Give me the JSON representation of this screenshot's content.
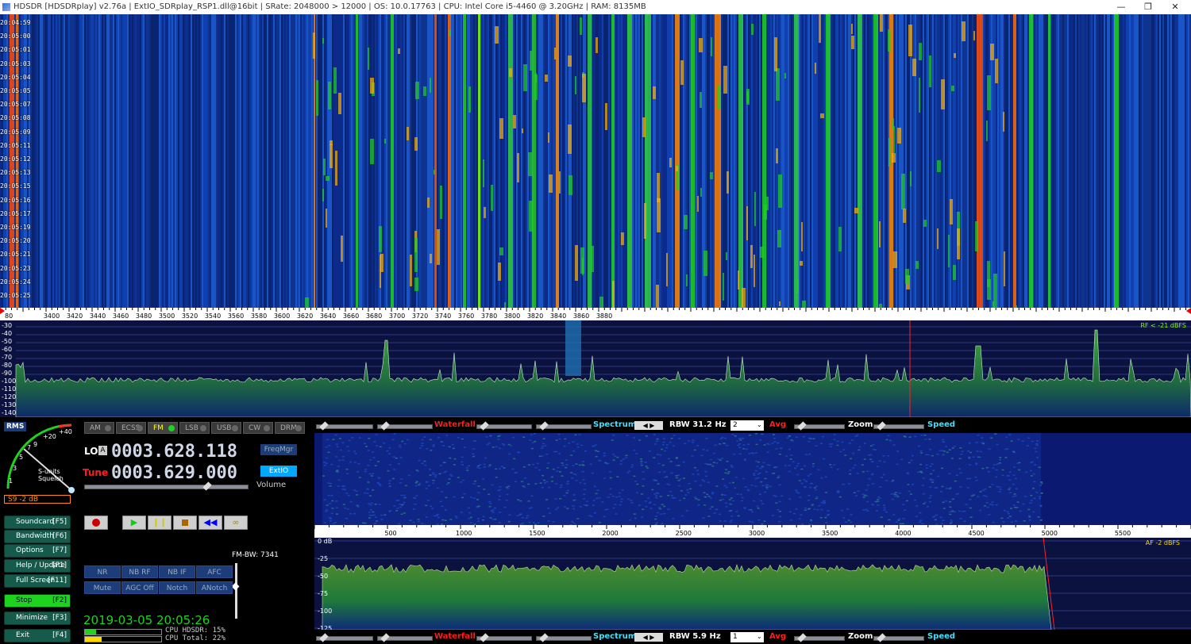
{
  "titlebar": {
    "title": "HDSDR  [HDSDRplay]  v2.76a  |  ExtIO_SDRplay_RSP1.dll@16bit  |  SRate: 2048000 > 12000  |  OS: 10.0.17763   |  CPU: Intel Core i5-4460  @ 3.20GHz  |  RAM: 8135MB",
    "minimize": "—",
    "restore": "❐",
    "close": "✕"
  },
  "waterfall_times": [
    "20:04:59",
    "20:05:00",
    "20:05:01",
    "20:05:03",
    "20:05:04",
    "20:05:05",
    "20:05:07",
    "20:05:08",
    "20:05:09",
    "20:05:11",
    "20:05:12",
    "20:05:13",
    "20:05:15",
    "20:05:16",
    "20:05:17",
    "20:05:19",
    "20:05:20",
    "20:05:21",
    "20:05:23",
    "20:05:24",
    "20:05:25"
  ],
  "freq_scale": [
    "3400",
    "3420",
    "3440",
    "3460",
    "3480",
    "3500",
    "3520",
    "3540",
    "3560",
    "3580",
    "3600",
    "3620",
    "3640",
    "3660",
    "3680",
    "3700",
    "3720",
    "3740",
    "3760",
    "3780",
    "3800",
    "3820",
    "3840",
    "3860",
    "3880"
  ],
  "freq_scale_left_label": "80",
  "rf_db_labels": [
    "-30",
    "-40",
    "-50",
    "-60",
    "-70",
    "-80",
    "-90",
    "-100",
    "-110",
    "-120",
    "-130",
    "-140"
  ],
  "rf_level_text": "RF  < -21 dBFS",
  "meter": {
    "rms_label": "RMS",
    "scale": [
      "1",
      "3",
      "5",
      "7",
      "9",
      "+20",
      "+40"
    ],
    "s_units": "S-units",
    "squelch": "Squelch",
    "readout": "S9 -2 dB"
  },
  "modes": [
    {
      "label": "AM",
      "active": false
    },
    {
      "label": "ECSS",
      "active": false
    },
    {
      "label": "FM",
      "active": true
    },
    {
      "label": "LSB",
      "active": false
    },
    {
      "label": "USB",
      "active": false
    },
    {
      "label": "CW",
      "active": false
    },
    {
      "label": "DRM",
      "active": false
    }
  ],
  "lo": {
    "label": "LO",
    "badge": "A",
    "value": "0003.628.118"
  },
  "tune": {
    "label": "Tune",
    "value": "0003.629.000"
  },
  "freqmgr_label": "FreqMgr",
  "extio_label": "ExtIO",
  "volume_label": "Volume",
  "volume_level": 0.75,
  "fmbw_label": "FM-BW: 7341",
  "side_buttons": [
    {
      "label": "Soundcard",
      "key": "[F5]"
    },
    {
      "label": "Bandwidth",
      "key": "[F6]"
    },
    {
      "label": "Options",
      "key": "[F7]"
    },
    {
      "label": "Help / Update",
      "key": "[F1]"
    },
    {
      "label": "Full Screen",
      "key": "[F11]"
    },
    {
      "label": "Stop",
      "key": "[F2]"
    },
    {
      "label": "Minimize",
      "key": "[F3]"
    },
    {
      "label": "Exit",
      "key": "[F4]"
    }
  ],
  "dsp_buttons_row1": [
    "NR",
    "NB RF",
    "NB IF",
    "AFC"
  ],
  "dsp_buttons_row2": [
    "Mute",
    "AGC Off",
    "Notch",
    "ANotch"
  ],
  "datetime": "2019-03-05 20:05:26",
  "cpu": {
    "hdsdr": "CPU HDSDR: 15%",
    "total": "CPU Total: 22%",
    "hdsdr_pct": 15,
    "total_pct": 22
  },
  "ctrl_row_top": {
    "waterfall": "Waterfall",
    "spectrum": "Spectrum",
    "rbw": "RBW 31.2 Hz",
    "avg_value": "2",
    "avg": "Avg",
    "zoom": "Zoom",
    "speed": "Speed"
  },
  "ctrl_row_bottom": {
    "waterfall": "Waterfall",
    "spectrum": "Spectrum",
    "rbw": "RBW  5.9 Hz",
    "avg_value": "1",
    "avg": "Avg",
    "zoom": "Zoom",
    "speed": "Speed"
  },
  "af_scale": [
    "500",
    "1000",
    "1500",
    "2000",
    "2500",
    "3000",
    "3500",
    "4000",
    "4500",
    "5000",
    "5500"
  ],
  "af_db_labels": [
    "0 dB",
    "-25",
    "-50",
    "-75",
    "-100",
    "-125"
  ],
  "af_level_text": "AF  -2 dBFS",
  "colors": {
    "accent_green": "#1fd21f",
    "accent_cyan": "#40e0ff",
    "accent_red": "#ff2020",
    "wf_bg": "#0a1a5e",
    "button_green": "#155a4a"
  }
}
